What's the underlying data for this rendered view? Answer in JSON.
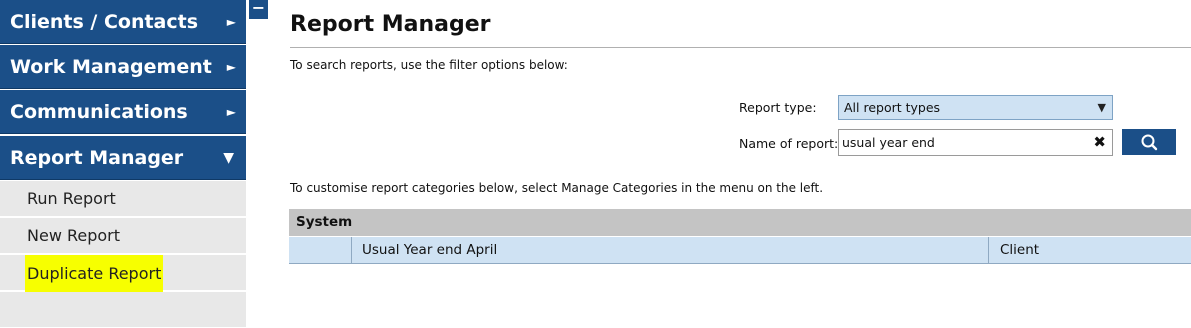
{
  "sidebar": {
    "nav": [
      {
        "label": "Clients / Contacts",
        "expanded": false
      },
      {
        "label": "Work Management",
        "expanded": false
      },
      {
        "label": "Communications",
        "expanded": false
      },
      {
        "label": "Report Manager",
        "expanded": true
      }
    ],
    "sub_items": [
      {
        "label": "Run Report"
      },
      {
        "label": "New Report"
      },
      {
        "label": "Duplicate Report",
        "highlighted": true
      }
    ],
    "collapse_symbol": "−"
  },
  "main": {
    "title": "Report Manager",
    "instruction_filter": "To search reports, use the filter options below:",
    "instruction_categories": "To customise report categories below, select Manage Categories in the menu on the left.",
    "filters": {
      "report_type_label": "Report type:",
      "report_type_value": "All report types",
      "name_label": "Name of report:",
      "name_value": "usual year end"
    },
    "table": {
      "category": "System",
      "rows": [
        {
          "col0": "",
          "name": "Usual Year end April",
          "type": "Client"
        }
      ]
    }
  },
  "colors": {
    "nav_bg": "#1b4f88",
    "sub_bg": "#e8e8e8",
    "highlight": "#f7ff00",
    "row_bg": "#cfe2f3",
    "header_bg": "#c4c4c4"
  }
}
